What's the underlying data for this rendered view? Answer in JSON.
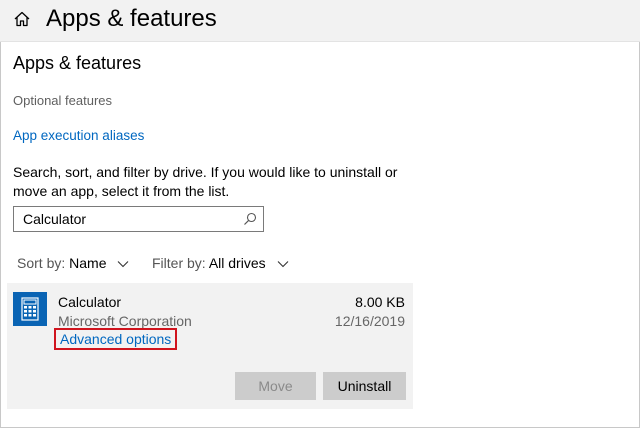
{
  "window": {
    "title": "Apps & features"
  },
  "page": {
    "title": "Apps & features",
    "optional_features": "Optional features",
    "execution_aliases": "App execution aliases",
    "description": "Search, sort, and filter by drive. If you would like to uninstall or move an app, select it from the list."
  },
  "search": {
    "value": "Calculator",
    "icon": "search-icon"
  },
  "sort": {
    "label": "Sort by:",
    "value": "Name"
  },
  "filter": {
    "label": "Filter by:",
    "value": "All drives"
  },
  "app": {
    "name": "Calculator",
    "publisher": "Microsoft Corporation",
    "size": "8.00 KB",
    "date": "12/16/2019",
    "advanced_options": "Advanced options",
    "icon": "calculator-icon"
  },
  "buttons": {
    "move": "Move",
    "uninstall": "Uninstall"
  },
  "colors": {
    "accent": "#0067c0",
    "app_icon_bg": "#0a64b4",
    "highlight": "#d0141e",
    "panel_bg": "#f2f2f2"
  }
}
